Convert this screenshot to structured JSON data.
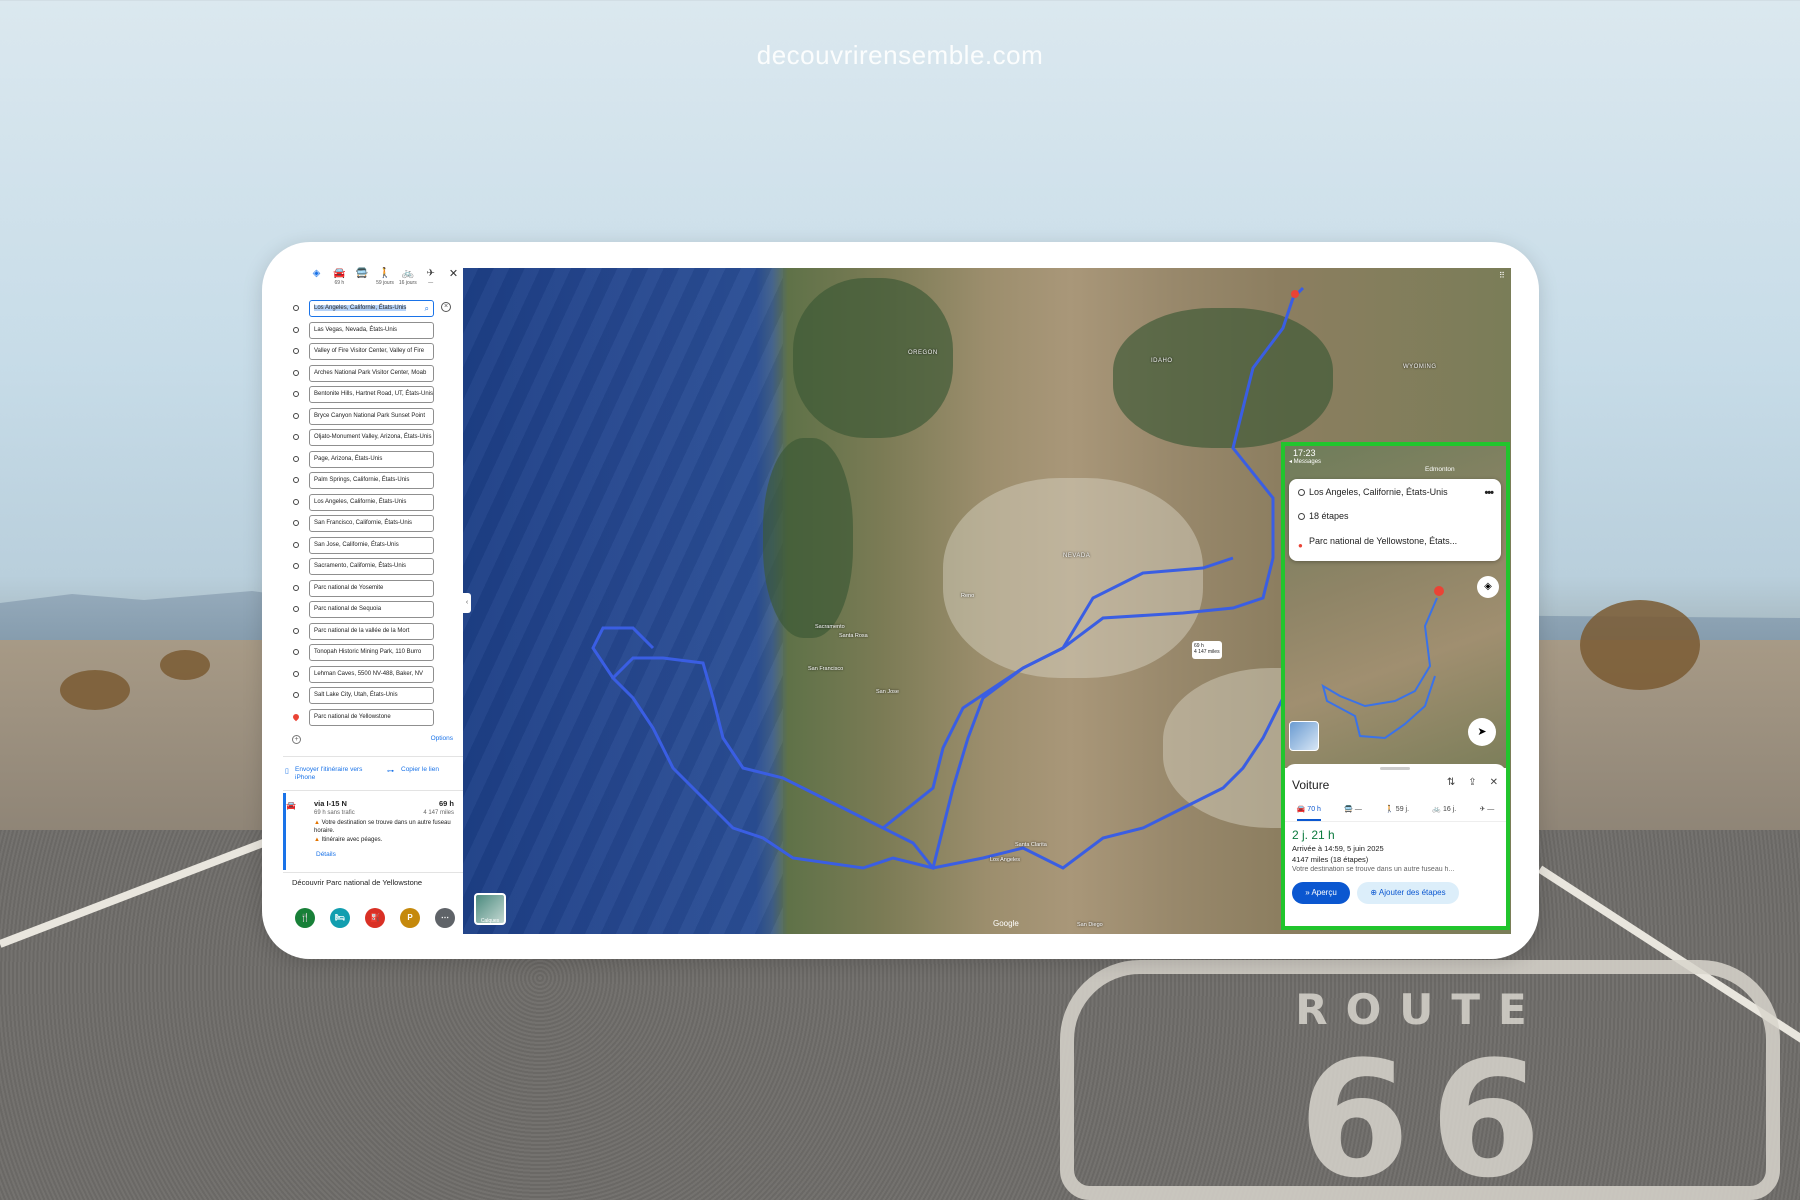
{
  "watermark": "decouvrirensemble.com",
  "sidebar": {
    "modes": [
      {
        "icon": "best-route-icon",
        "glyph": "◈",
        "sub": ""
      },
      {
        "icon": "car-icon",
        "glyph": "🚘",
        "sub": "69 h"
      },
      {
        "icon": "transit-icon",
        "glyph": "🚍",
        "sub": ""
      },
      {
        "icon": "walk-icon",
        "glyph": "🚶",
        "sub": "59 jours"
      },
      {
        "icon": "bike-icon",
        "glyph": "🚲",
        "sub": "16 jours"
      },
      {
        "icon": "flight-icon",
        "glyph": "✈",
        "sub": "—"
      }
    ],
    "close": "✕",
    "waypoints": [
      "Los Angeles, Californie, États-Unis",
      "Las Vegas, Nevada, États-Unis",
      "Valley of Fire Visitor Center, Valley of Fire",
      "Arches National Park Visitor Center, Moab",
      "Bentonite Hills, Hartnet Road, UT, États-Unis",
      "Bryce Canyon National Park Sunset Point",
      "Oljato-Monument Valley, Arizona, États-Unis",
      "Page, Arizona, États-Unis",
      "Palm Springs, Californie, États-Unis",
      "Los Angeles, Californie, États-Unis",
      "San Francisco, Californie, États-Unis",
      "San Jose, Californie, États-Unis",
      "Sacramento, Californie, États-Unis",
      "Parc national de Yosemite",
      "Parc national de Sequoia",
      "Parc national de la vallée de la Mort",
      "Tonopah Historic Mining Park, 110 Burro",
      "Lehman Caves, 5500 NV-488, Baker, NV",
      "Salt Lake City, Utah, États-Unis",
      "Parc national de Yellowstone"
    ],
    "options_label": "Options",
    "send_to_phone": "Envoyer l'itinéraire vers iPhone",
    "copy_link": "Copier le lien",
    "route": {
      "via": "via I-15 N",
      "time": "69 h",
      "traffic": "69 h sans trafic",
      "miles": "4 147 miles",
      "warning_tz": "Votre destination se trouve dans un autre fuseau horaire.",
      "warning_toll": "Itinéraire avec péages.",
      "details": "Détails"
    },
    "discover": "Découvrir Parc national de Yellowstone",
    "categories": [
      {
        "name": "restaurants",
        "glyph": "🍴",
        "color": "#188038"
      },
      {
        "name": "hotels",
        "glyph": "🛏",
        "color": "#129eaf"
      },
      {
        "name": "gas",
        "glyph": "⛽",
        "color": "#d93025"
      },
      {
        "name": "parking",
        "glyph": "P",
        "color": "#c5890c"
      },
      {
        "name": "more",
        "glyph": "⋯",
        "color": "#5f6368"
      }
    ]
  },
  "map": {
    "labels": [
      {
        "text": "OREGON",
        "type": "state"
      },
      {
        "text": "IDAHO",
        "type": "state"
      },
      {
        "text": "WYOMING",
        "type": "state"
      },
      {
        "text": "NEVADA",
        "type": "state"
      },
      {
        "text": "Sacramento",
        "type": "city"
      },
      {
        "text": "Santa Rosa",
        "type": "city"
      },
      {
        "text": "San Francisco",
        "type": "city"
      },
      {
        "text": "San Jose",
        "type": "city"
      },
      {
        "text": "Los Angeles",
        "type": "city"
      },
      {
        "text": "San Diego",
        "type": "city"
      },
      {
        "text": "Santa Clarita",
        "type": "city"
      },
      {
        "text": "Reno",
        "type": "city"
      }
    ],
    "route_badge": {
      "time": "69 h",
      "miles": "4 147 miles"
    },
    "layers_label": "Calques",
    "google": "Google"
  },
  "phone": {
    "time": "17:23",
    "back": "◂ Messages",
    "edmonton": "Edmonton",
    "origin": "Los Angeles, Californie, États-Unis",
    "stops": "18 étapes",
    "destination": "Parc national de Yellowstone, États...",
    "more": "•••",
    "sheet": {
      "title": "Voiture",
      "tabs": [
        {
          "label": "70 h",
          "glyph": "🚘",
          "active": true
        },
        {
          "label": "—",
          "glyph": "🚍",
          "active": false
        },
        {
          "label": "59 j.",
          "glyph": "🚶",
          "active": false
        },
        {
          "label": "16 j.",
          "glyph": "🚲",
          "active": false
        },
        {
          "label": "—",
          "glyph": "✈",
          "active": false
        }
      ],
      "duration": "2 j. 21 h",
      "arrival": "Arrivée à 14:59, 5 juin 2025",
      "miles": "4147 miles (18 étapes)",
      "note": "Votre destination se trouve dans un autre fuseau h...",
      "overview_btn": "Aperçu",
      "add_stops_btn": "Ajouter des étapes"
    }
  },
  "colors": {
    "accent": "#1a73e8",
    "highlight_frame": "#21c52d",
    "route_line": "#3a5ee3"
  }
}
